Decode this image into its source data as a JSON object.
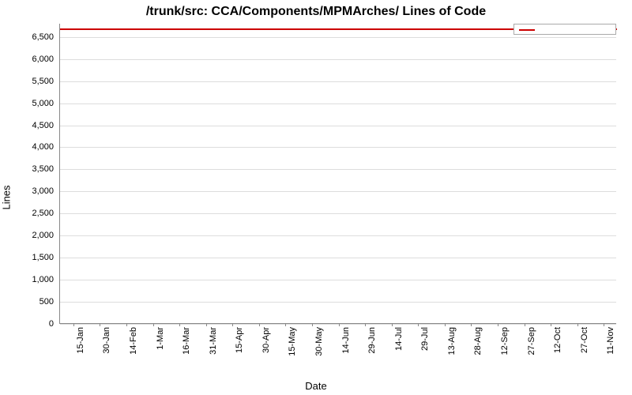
{
  "chart_data": {
    "type": "line",
    "title": "/trunk/src: CCA/Components/MPMArches/ Lines of Code",
    "xlabel": "Date",
    "ylabel": "Lines",
    "ylim": [
      0,
      6800
    ],
    "y_ticks": [
      0,
      500,
      1000,
      1500,
      2000,
      2500,
      3000,
      3500,
      4000,
      4500,
      5000,
      5500,
      6000,
      6500
    ],
    "x_categories": [
      "15-Jan",
      "30-Jan",
      "14-Feb",
      "1-Mar",
      "16-Mar",
      "31-Mar",
      "15-Apr",
      "30-Apr",
      "15-May",
      "30-May",
      "14-Jun",
      "29-Jun",
      "14-Jul",
      "29-Jul",
      "13-Aug",
      "28-Aug",
      "12-Sep",
      "27-Sep",
      "12-Oct",
      "27-Oct",
      "11-Nov"
    ],
    "series": [
      {
        "name": "",
        "color": "#cc0000",
        "values": [
          6700,
          6700,
          6700,
          6700,
          6700,
          6700,
          6700,
          6700,
          6700,
          6700,
          6700,
          6700,
          6700,
          6700,
          6700,
          6700,
          6700,
          6700,
          6700,
          6700,
          6700
        ]
      }
    ],
    "legend": {
      "position": "top-right",
      "entries": [
        ""
      ]
    }
  }
}
